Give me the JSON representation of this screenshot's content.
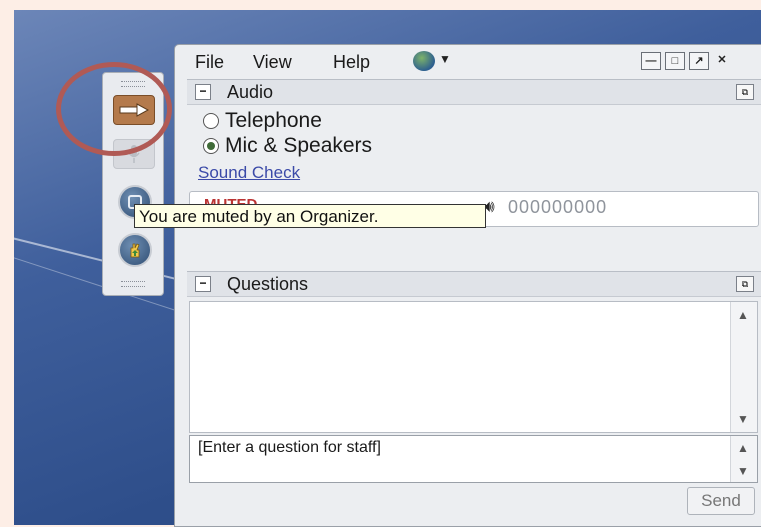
{
  "menu": {
    "file": "File",
    "view": "View",
    "help": "Help"
  },
  "window_controls": {
    "minimize": "—",
    "maximize": "□",
    "popout": "↗",
    "close": "✕"
  },
  "audio": {
    "title": "Audio",
    "collapse": "−",
    "options": [
      {
        "label": "Telephone",
        "selected": false
      },
      {
        "label": "Mic & Speakers",
        "selected": true
      }
    ],
    "sound_check": "Sound Check",
    "muted_label": "MUTED",
    "level_digits": "000000000"
  },
  "questions": {
    "title": "Questions",
    "collapse": "−",
    "entry_text": "[Enter a question for staff]",
    "send_label": "Send"
  },
  "tooltip": "You are muted by an Organizer.",
  "icons": {
    "arrow": "arrow-right-icon",
    "mic": "microphone-icon",
    "screen": "screen-share-icon",
    "hand": "raise-hand-icon",
    "globe": "globe-icon"
  },
  "colors": {
    "highlight_circle": "#b05a55",
    "muted_text": "#b33333",
    "link": "#3b4aa8"
  }
}
